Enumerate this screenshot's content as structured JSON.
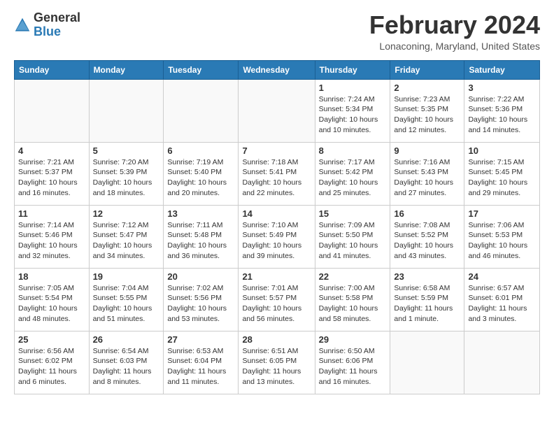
{
  "header": {
    "logo_general": "General",
    "logo_blue": "Blue",
    "month_title": "February 2024",
    "location": "Lonaconing, Maryland, United States"
  },
  "days_of_week": [
    "Sunday",
    "Monday",
    "Tuesday",
    "Wednesday",
    "Thursday",
    "Friday",
    "Saturday"
  ],
  "weeks": [
    [
      {
        "day": "",
        "info": ""
      },
      {
        "day": "",
        "info": ""
      },
      {
        "day": "",
        "info": ""
      },
      {
        "day": "",
        "info": ""
      },
      {
        "day": "1",
        "info": "Sunrise: 7:24 AM\nSunset: 5:34 PM\nDaylight: 10 hours\nand 10 minutes."
      },
      {
        "day": "2",
        "info": "Sunrise: 7:23 AM\nSunset: 5:35 PM\nDaylight: 10 hours\nand 12 minutes."
      },
      {
        "day": "3",
        "info": "Sunrise: 7:22 AM\nSunset: 5:36 PM\nDaylight: 10 hours\nand 14 minutes."
      }
    ],
    [
      {
        "day": "4",
        "info": "Sunrise: 7:21 AM\nSunset: 5:37 PM\nDaylight: 10 hours\nand 16 minutes."
      },
      {
        "day": "5",
        "info": "Sunrise: 7:20 AM\nSunset: 5:39 PM\nDaylight: 10 hours\nand 18 minutes."
      },
      {
        "day": "6",
        "info": "Sunrise: 7:19 AM\nSunset: 5:40 PM\nDaylight: 10 hours\nand 20 minutes."
      },
      {
        "day": "7",
        "info": "Sunrise: 7:18 AM\nSunset: 5:41 PM\nDaylight: 10 hours\nand 22 minutes."
      },
      {
        "day": "8",
        "info": "Sunrise: 7:17 AM\nSunset: 5:42 PM\nDaylight: 10 hours\nand 25 minutes."
      },
      {
        "day": "9",
        "info": "Sunrise: 7:16 AM\nSunset: 5:43 PM\nDaylight: 10 hours\nand 27 minutes."
      },
      {
        "day": "10",
        "info": "Sunrise: 7:15 AM\nSunset: 5:45 PM\nDaylight: 10 hours\nand 29 minutes."
      }
    ],
    [
      {
        "day": "11",
        "info": "Sunrise: 7:14 AM\nSunset: 5:46 PM\nDaylight: 10 hours\nand 32 minutes."
      },
      {
        "day": "12",
        "info": "Sunrise: 7:12 AM\nSunset: 5:47 PM\nDaylight: 10 hours\nand 34 minutes."
      },
      {
        "day": "13",
        "info": "Sunrise: 7:11 AM\nSunset: 5:48 PM\nDaylight: 10 hours\nand 36 minutes."
      },
      {
        "day": "14",
        "info": "Sunrise: 7:10 AM\nSunset: 5:49 PM\nDaylight: 10 hours\nand 39 minutes."
      },
      {
        "day": "15",
        "info": "Sunrise: 7:09 AM\nSunset: 5:50 PM\nDaylight: 10 hours\nand 41 minutes."
      },
      {
        "day": "16",
        "info": "Sunrise: 7:08 AM\nSunset: 5:52 PM\nDaylight: 10 hours\nand 43 minutes."
      },
      {
        "day": "17",
        "info": "Sunrise: 7:06 AM\nSunset: 5:53 PM\nDaylight: 10 hours\nand 46 minutes."
      }
    ],
    [
      {
        "day": "18",
        "info": "Sunrise: 7:05 AM\nSunset: 5:54 PM\nDaylight: 10 hours\nand 48 minutes."
      },
      {
        "day": "19",
        "info": "Sunrise: 7:04 AM\nSunset: 5:55 PM\nDaylight: 10 hours\nand 51 minutes."
      },
      {
        "day": "20",
        "info": "Sunrise: 7:02 AM\nSunset: 5:56 PM\nDaylight: 10 hours\nand 53 minutes."
      },
      {
        "day": "21",
        "info": "Sunrise: 7:01 AM\nSunset: 5:57 PM\nDaylight: 10 hours\nand 56 minutes."
      },
      {
        "day": "22",
        "info": "Sunrise: 7:00 AM\nSunset: 5:58 PM\nDaylight: 10 hours\nand 58 minutes."
      },
      {
        "day": "23",
        "info": "Sunrise: 6:58 AM\nSunset: 5:59 PM\nDaylight: 11 hours\nand 1 minute."
      },
      {
        "day": "24",
        "info": "Sunrise: 6:57 AM\nSunset: 6:01 PM\nDaylight: 11 hours\nand 3 minutes."
      }
    ],
    [
      {
        "day": "25",
        "info": "Sunrise: 6:56 AM\nSunset: 6:02 PM\nDaylight: 11 hours\nand 6 minutes."
      },
      {
        "day": "26",
        "info": "Sunrise: 6:54 AM\nSunset: 6:03 PM\nDaylight: 11 hours\nand 8 minutes."
      },
      {
        "day": "27",
        "info": "Sunrise: 6:53 AM\nSunset: 6:04 PM\nDaylight: 11 hours\nand 11 minutes."
      },
      {
        "day": "28",
        "info": "Sunrise: 6:51 AM\nSunset: 6:05 PM\nDaylight: 11 hours\nand 13 minutes."
      },
      {
        "day": "29",
        "info": "Sunrise: 6:50 AM\nSunset: 6:06 PM\nDaylight: 11 hours\nand 16 minutes."
      },
      {
        "day": "",
        "info": ""
      },
      {
        "day": "",
        "info": ""
      }
    ]
  ]
}
